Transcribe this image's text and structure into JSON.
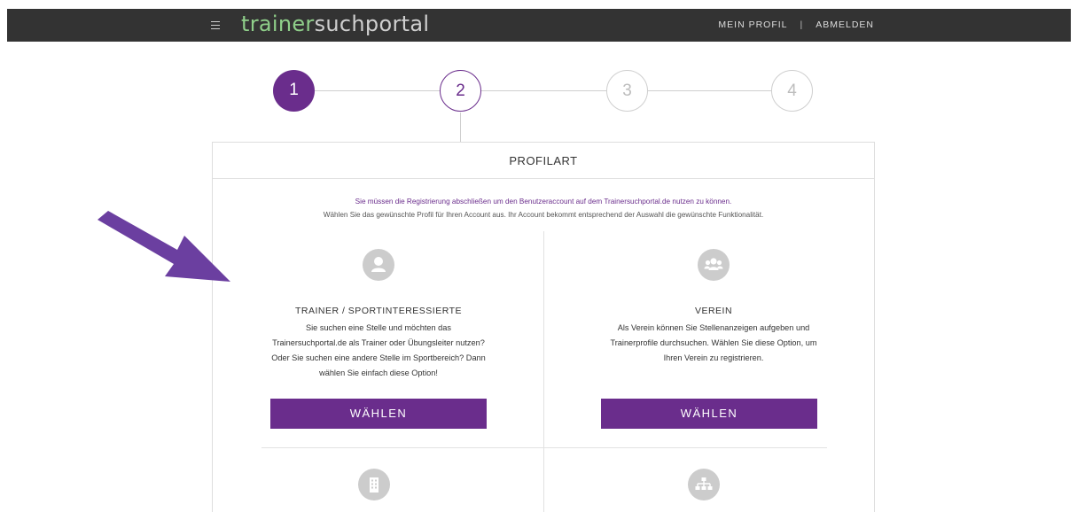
{
  "header": {
    "logo_part1": "trainer",
    "logo_part2": "suchportal",
    "nav_profile": "MEIN PROFIL",
    "nav_separator": "|",
    "nav_logout": "ABMELDEN"
  },
  "stepper": {
    "steps": [
      "1",
      "2",
      "3",
      "4"
    ],
    "active_step": 1,
    "current_step": 2
  },
  "card": {
    "title": "PROFILART",
    "notice": "Sie müssen die Registrierung abschließen um den Benutzeraccount auf dem Trainersuchportal.de nutzen zu können.",
    "info": "Wählen Sie das gewünschte Profil für Ihren Account aus. Ihr Account bekommt entsprechend der Auswahl die gewünschte Funktionalität."
  },
  "options": [
    {
      "icon": "user-icon",
      "title": "TRAINER / SPORTINTERESSIERTE",
      "description": "Sie suchen eine Stelle und möchten das Trainersuchportal.de als Trainer oder Übungsleiter nutzen? Oder Sie suchen eine andere Stelle im Sportbereich? Dann wählen Sie einfach diese Option!",
      "button_label": "WÄHLEN"
    },
    {
      "icon": "users-group-icon",
      "title": "VEREIN",
      "description": "Als Verein können Sie Stellenanzeigen aufgeben und Trainerprofile durchsuchen. Wählen Sie diese Option, um Ihren Verein zu registrieren.",
      "button_label": "WÄHLEN"
    },
    {
      "icon": "building-icon"
    },
    {
      "icon": "hierarchy-icon"
    }
  ],
  "colors": {
    "brand_purple": "#6a2d8c",
    "topbar": "#333333",
    "logo_green": "#8fcf8a",
    "icon_gray": "#cccccc",
    "arrow_purple": "#6b3fa0"
  }
}
